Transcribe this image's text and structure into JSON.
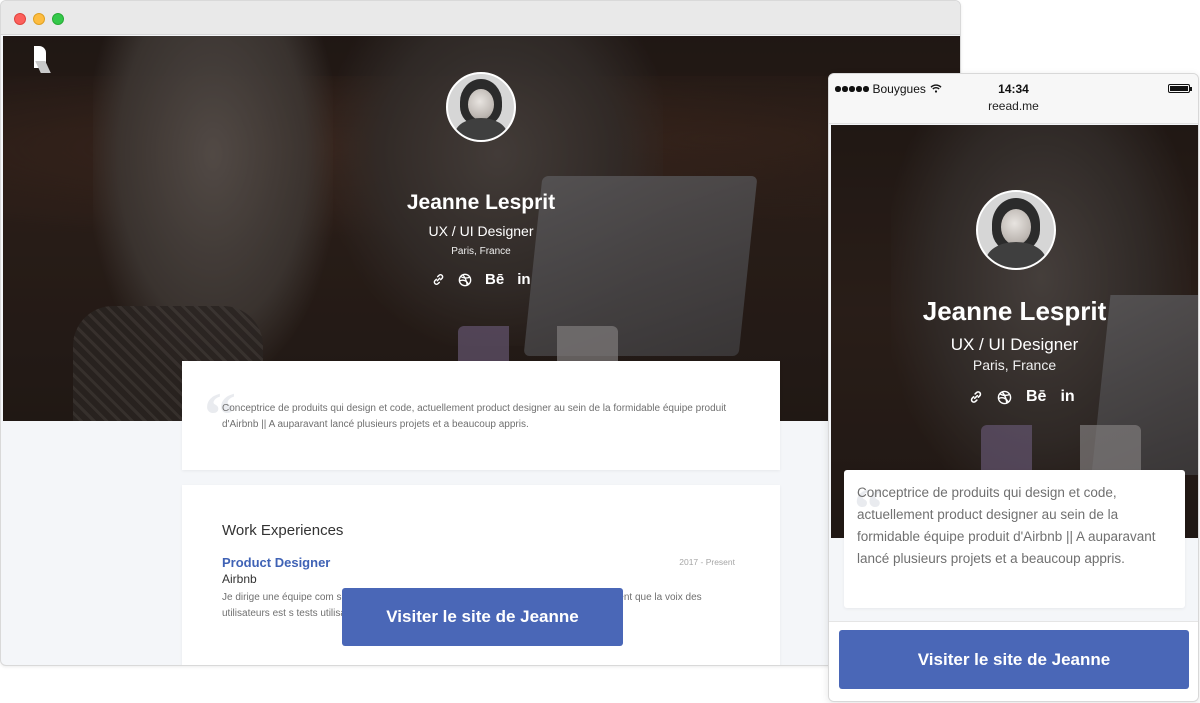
{
  "desktop": {
    "profile": {
      "name": "Jeanne Lesprit",
      "title": "UX / UI Designer",
      "location": "Paris, France",
      "social": [
        "link-icon",
        "dribbble-icon",
        "behance-icon",
        "linkedin-icon"
      ],
      "behance_label": "Bē",
      "linkedin_label": "in"
    },
    "bio": {
      "quote": "“",
      "text": "Conceptrice de produits qui design et code, actuellement product designer au sein de la formidable équipe produit d'Airbnb || A auparavant lancé plusieurs projets et a beaucoup appris."
    },
    "experience": {
      "section_title": "Work Experiences",
      "job_title": "Product Designer",
      "company": "Airbnb",
      "dates": "2017 - Present",
      "description": "Je dirige une équipe com            s chez Airbnb. Notre mission est de construire           us croyons vraiment que la voix des utilisateurs est          s tests utilisateurs hebdomadaires."
    },
    "cta": "Visiter le site de Jeanne"
  },
  "mobile": {
    "status": {
      "carrier": "Bouygues",
      "time": "14:34",
      "url": "reead.me"
    },
    "profile": {
      "name": "Jeanne Lesprit",
      "title": "UX / UI Designer",
      "location": "Paris, France",
      "behance_label": "Bē",
      "linkedin_label": "in"
    },
    "bio": {
      "quote": "“",
      "text": "Conceptrice de produits qui design et code, actuellement product designer au sein de la formidable équipe produit d'Airbnb || A auparavant lancé plusieurs projets et a beaucoup appris."
    },
    "cta": "Visiter le site de Jeanne"
  },
  "colors": {
    "accent": "#4a67b7",
    "link": "#3f62b5",
    "page_bg": "#f4f6f9"
  }
}
